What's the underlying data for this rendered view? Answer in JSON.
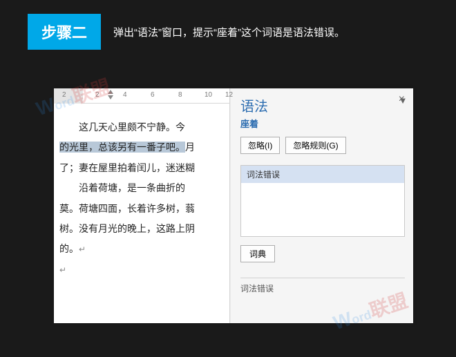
{
  "header": {
    "step_label": "步骤二",
    "description": "弹出“语法”窗口，提示“座着”这个词语是语法错误。"
  },
  "ruler": {
    "ticks": [
      "2",
      "2",
      "4",
      "6",
      "8",
      "10",
      "12"
    ]
  },
  "document": {
    "line1_indent": "这几天心里颇不宁静。今",
    "line2_hl": "的光里，总该另有一番子吧。",
    "line2_tail": "月",
    "line3": "了；妻在屋里拍着闰儿，迷迷糊",
    "line4_indent": "沿着荷塘，是一条曲折的",
    "line5": "莫。荷塘四面，长着许多树，蓊",
    "line6": "树。没有月光的晚上，这路上阴",
    "line7": "的。"
  },
  "grammar_pane": {
    "title": "语法",
    "subtitle": "座着",
    "dropdown_icon": "▼",
    "close_icon": "×",
    "btn_ignore": "忽略(I)",
    "btn_ignore_rule": "忽略规则(G)",
    "error_item": "词法错误",
    "btn_dictionary": "词典",
    "section_label": "词法错误"
  },
  "watermark": {
    "left": "W",
    "mid": "ord",
    "right": "联盟"
  }
}
